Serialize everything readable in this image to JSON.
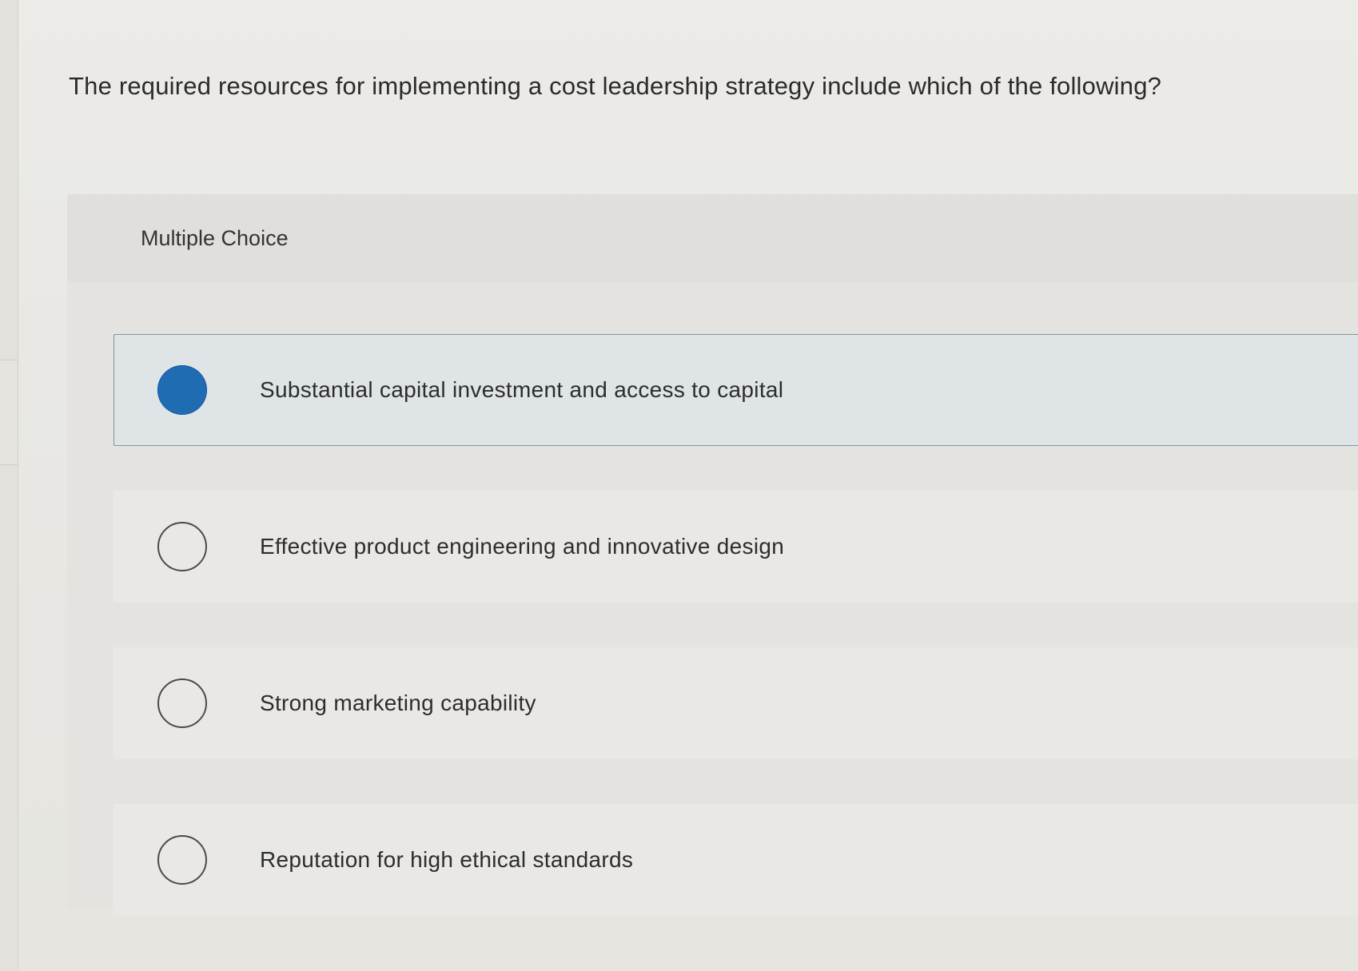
{
  "question": {
    "text": "The required resources for implementing a cost leadership strategy include which of the following?"
  },
  "panel": {
    "type_label": "Multiple Choice"
  },
  "options": [
    {
      "label": "Substantial capital investment and access to capital",
      "selected": true
    },
    {
      "label": "Effective product engineering and innovative design",
      "selected": false
    },
    {
      "label": "Strong marketing capability",
      "selected": false
    },
    {
      "label": "Reputation for high ethical standards",
      "selected": false
    }
  ],
  "colors": {
    "selected_radio": "#1f6cb3",
    "selected_background": "#dfe4e6"
  }
}
